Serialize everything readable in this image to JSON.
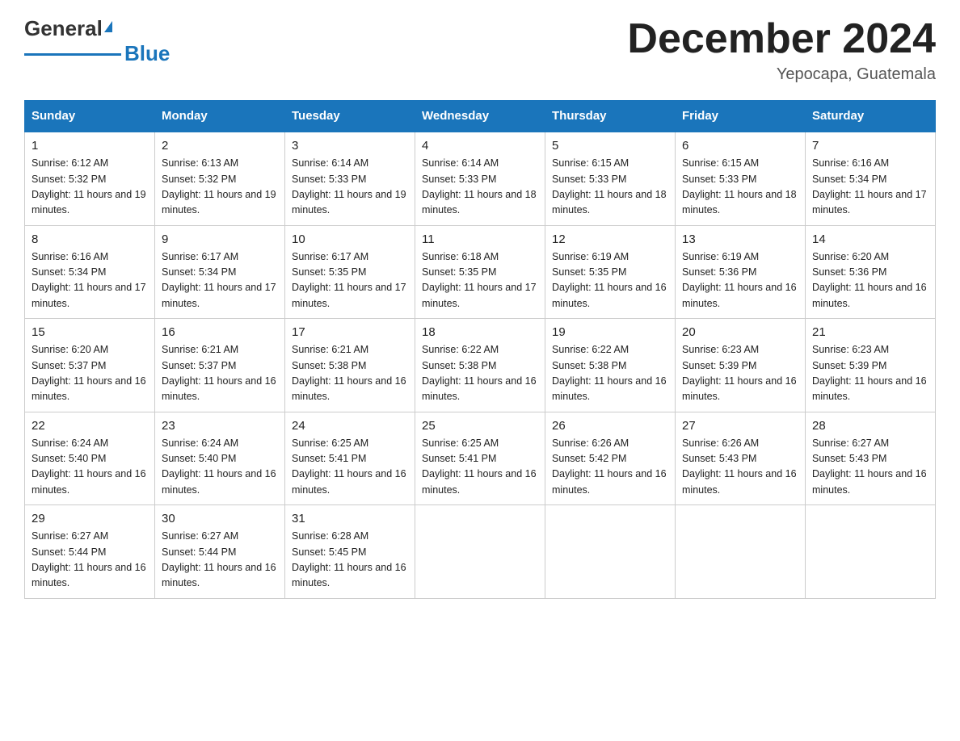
{
  "header": {
    "logo_general": "General",
    "logo_blue": "Blue",
    "month_title": "December 2024",
    "subtitle": "Yepocapa, Guatemala"
  },
  "calendar": {
    "days_of_week": [
      "Sunday",
      "Monday",
      "Tuesday",
      "Wednesday",
      "Thursday",
      "Friday",
      "Saturday"
    ],
    "weeks": [
      [
        {
          "day": "1",
          "sunrise": "6:12 AM",
          "sunset": "5:32 PM",
          "daylight": "11 hours and 19 minutes."
        },
        {
          "day": "2",
          "sunrise": "6:13 AM",
          "sunset": "5:32 PM",
          "daylight": "11 hours and 19 minutes."
        },
        {
          "day": "3",
          "sunrise": "6:14 AM",
          "sunset": "5:33 PM",
          "daylight": "11 hours and 19 minutes."
        },
        {
          "day": "4",
          "sunrise": "6:14 AM",
          "sunset": "5:33 PM",
          "daylight": "11 hours and 18 minutes."
        },
        {
          "day": "5",
          "sunrise": "6:15 AM",
          "sunset": "5:33 PM",
          "daylight": "11 hours and 18 minutes."
        },
        {
          "day": "6",
          "sunrise": "6:15 AM",
          "sunset": "5:33 PM",
          "daylight": "11 hours and 18 minutes."
        },
        {
          "day": "7",
          "sunrise": "6:16 AM",
          "sunset": "5:34 PM",
          "daylight": "11 hours and 17 minutes."
        }
      ],
      [
        {
          "day": "8",
          "sunrise": "6:16 AM",
          "sunset": "5:34 PM",
          "daylight": "11 hours and 17 minutes."
        },
        {
          "day": "9",
          "sunrise": "6:17 AM",
          "sunset": "5:34 PM",
          "daylight": "11 hours and 17 minutes."
        },
        {
          "day": "10",
          "sunrise": "6:17 AM",
          "sunset": "5:35 PM",
          "daylight": "11 hours and 17 minutes."
        },
        {
          "day": "11",
          "sunrise": "6:18 AM",
          "sunset": "5:35 PM",
          "daylight": "11 hours and 17 minutes."
        },
        {
          "day": "12",
          "sunrise": "6:19 AM",
          "sunset": "5:35 PM",
          "daylight": "11 hours and 16 minutes."
        },
        {
          "day": "13",
          "sunrise": "6:19 AM",
          "sunset": "5:36 PM",
          "daylight": "11 hours and 16 minutes."
        },
        {
          "day": "14",
          "sunrise": "6:20 AM",
          "sunset": "5:36 PM",
          "daylight": "11 hours and 16 minutes."
        }
      ],
      [
        {
          "day": "15",
          "sunrise": "6:20 AM",
          "sunset": "5:37 PM",
          "daylight": "11 hours and 16 minutes."
        },
        {
          "day": "16",
          "sunrise": "6:21 AM",
          "sunset": "5:37 PM",
          "daylight": "11 hours and 16 minutes."
        },
        {
          "day": "17",
          "sunrise": "6:21 AM",
          "sunset": "5:38 PM",
          "daylight": "11 hours and 16 minutes."
        },
        {
          "day": "18",
          "sunrise": "6:22 AM",
          "sunset": "5:38 PM",
          "daylight": "11 hours and 16 minutes."
        },
        {
          "day": "19",
          "sunrise": "6:22 AM",
          "sunset": "5:38 PM",
          "daylight": "11 hours and 16 minutes."
        },
        {
          "day": "20",
          "sunrise": "6:23 AM",
          "sunset": "5:39 PM",
          "daylight": "11 hours and 16 minutes."
        },
        {
          "day": "21",
          "sunrise": "6:23 AM",
          "sunset": "5:39 PM",
          "daylight": "11 hours and 16 minutes."
        }
      ],
      [
        {
          "day": "22",
          "sunrise": "6:24 AM",
          "sunset": "5:40 PM",
          "daylight": "11 hours and 16 minutes."
        },
        {
          "day": "23",
          "sunrise": "6:24 AM",
          "sunset": "5:40 PM",
          "daylight": "11 hours and 16 minutes."
        },
        {
          "day": "24",
          "sunrise": "6:25 AM",
          "sunset": "5:41 PM",
          "daylight": "11 hours and 16 minutes."
        },
        {
          "day": "25",
          "sunrise": "6:25 AM",
          "sunset": "5:41 PM",
          "daylight": "11 hours and 16 minutes."
        },
        {
          "day": "26",
          "sunrise": "6:26 AM",
          "sunset": "5:42 PM",
          "daylight": "11 hours and 16 minutes."
        },
        {
          "day": "27",
          "sunrise": "6:26 AM",
          "sunset": "5:43 PM",
          "daylight": "11 hours and 16 minutes."
        },
        {
          "day": "28",
          "sunrise": "6:27 AM",
          "sunset": "5:43 PM",
          "daylight": "11 hours and 16 minutes."
        }
      ],
      [
        {
          "day": "29",
          "sunrise": "6:27 AM",
          "sunset": "5:44 PM",
          "daylight": "11 hours and 16 minutes."
        },
        {
          "day": "30",
          "sunrise": "6:27 AM",
          "sunset": "5:44 PM",
          "daylight": "11 hours and 16 minutes."
        },
        {
          "day": "31",
          "sunrise": "6:28 AM",
          "sunset": "5:45 PM",
          "daylight": "11 hours and 16 minutes."
        },
        null,
        null,
        null,
        null
      ]
    ]
  }
}
